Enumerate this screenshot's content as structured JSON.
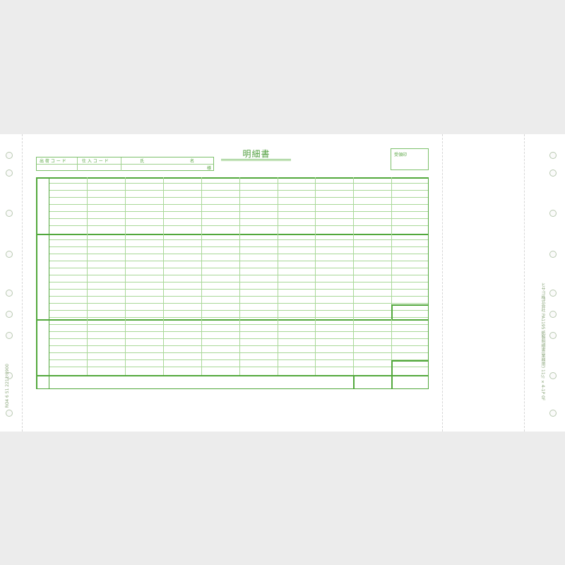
{
  "form": {
    "title": "明細書",
    "stamp_label": "受領印",
    "header_cells": [
      {
        "label": "出 荷 コ ー ド"
      },
      {
        "label": "仕 入 コ ー ド"
      },
      {
        "label": "氏"
      },
      {
        "label": "名"
      }
    ],
    "honorific": "様"
  },
  "margins": {
    "left_code": "RO4  6 51  2211-3900",
    "right_maker": "ヒサゴ株式会社  PA1195  紙製明細書(業務用)  11½×4-1P  0F",
    "left_mark": "0",
    "right_mark": "ヒサゴ"
  },
  "colors": {
    "form_green": "#52a83c",
    "light_green": "#a9d898",
    "paper": "#ffffff",
    "backdrop": "#ececec"
  }
}
